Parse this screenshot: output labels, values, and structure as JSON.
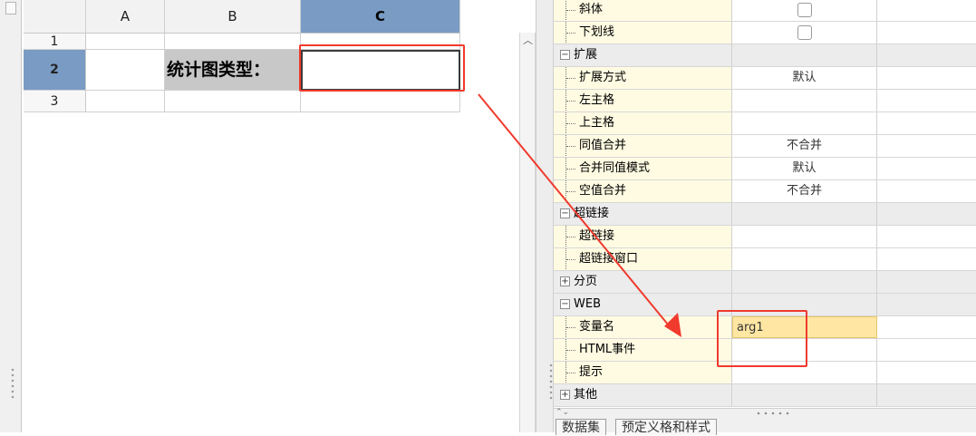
{
  "sheet": {
    "columns": [
      "A",
      "B",
      "C"
    ],
    "rows": [
      "1",
      "2",
      "3"
    ],
    "selected_column": "C",
    "selected_row": "2",
    "cell_b2_text": "统计图类型："
  },
  "properties": {
    "rows": [
      {
        "kind": "child",
        "label": "斜体",
        "value_type": "checkbox",
        "value": ""
      },
      {
        "kind": "child",
        "label": "下划线",
        "value_type": "checkbox",
        "value": ""
      },
      {
        "kind": "section",
        "label": "扩展",
        "expander": "−"
      },
      {
        "kind": "child",
        "label": "扩展方式",
        "value": "默认"
      },
      {
        "kind": "child",
        "label": "左主格",
        "value": ""
      },
      {
        "kind": "child",
        "label": "上主格",
        "value": ""
      },
      {
        "kind": "child",
        "label": "同值合并",
        "value": "不合并"
      },
      {
        "kind": "child",
        "label": "合并同值模式",
        "value": "默认"
      },
      {
        "kind": "child",
        "label": "空值合并",
        "value": "不合并"
      },
      {
        "kind": "section",
        "label": "超链接",
        "expander": "−"
      },
      {
        "kind": "child",
        "label": "超链接",
        "value": ""
      },
      {
        "kind": "child",
        "label": "超链接窗口",
        "value": ""
      },
      {
        "kind": "section",
        "label": "分页",
        "expander": "+"
      },
      {
        "kind": "section",
        "label": "WEB",
        "expander": "−"
      },
      {
        "kind": "child",
        "label": "变量名",
        "value": "arg1",
        "editing": true
      },
      {
        "kind": "child",
        "label": "HTML事件",
        "value": ""
      },
      {
        "kind": "child",
        "label": "提示",
        "value": ""
      },
      {
        "kind": "section",
        "label": "其他",
        "expander": "+"
      }
    ]
  },
  "bottom_tabs": [
    "数据集",
    "预定义格和样式"
  ],
  "colors": {
    "highlight_red": "#f03a2e",
    "selected_header": "#7a9cc4",
    "property_name_bg": "#fffbe2",
    "editing_value_bg": "#ffe7a3"
  }
}
